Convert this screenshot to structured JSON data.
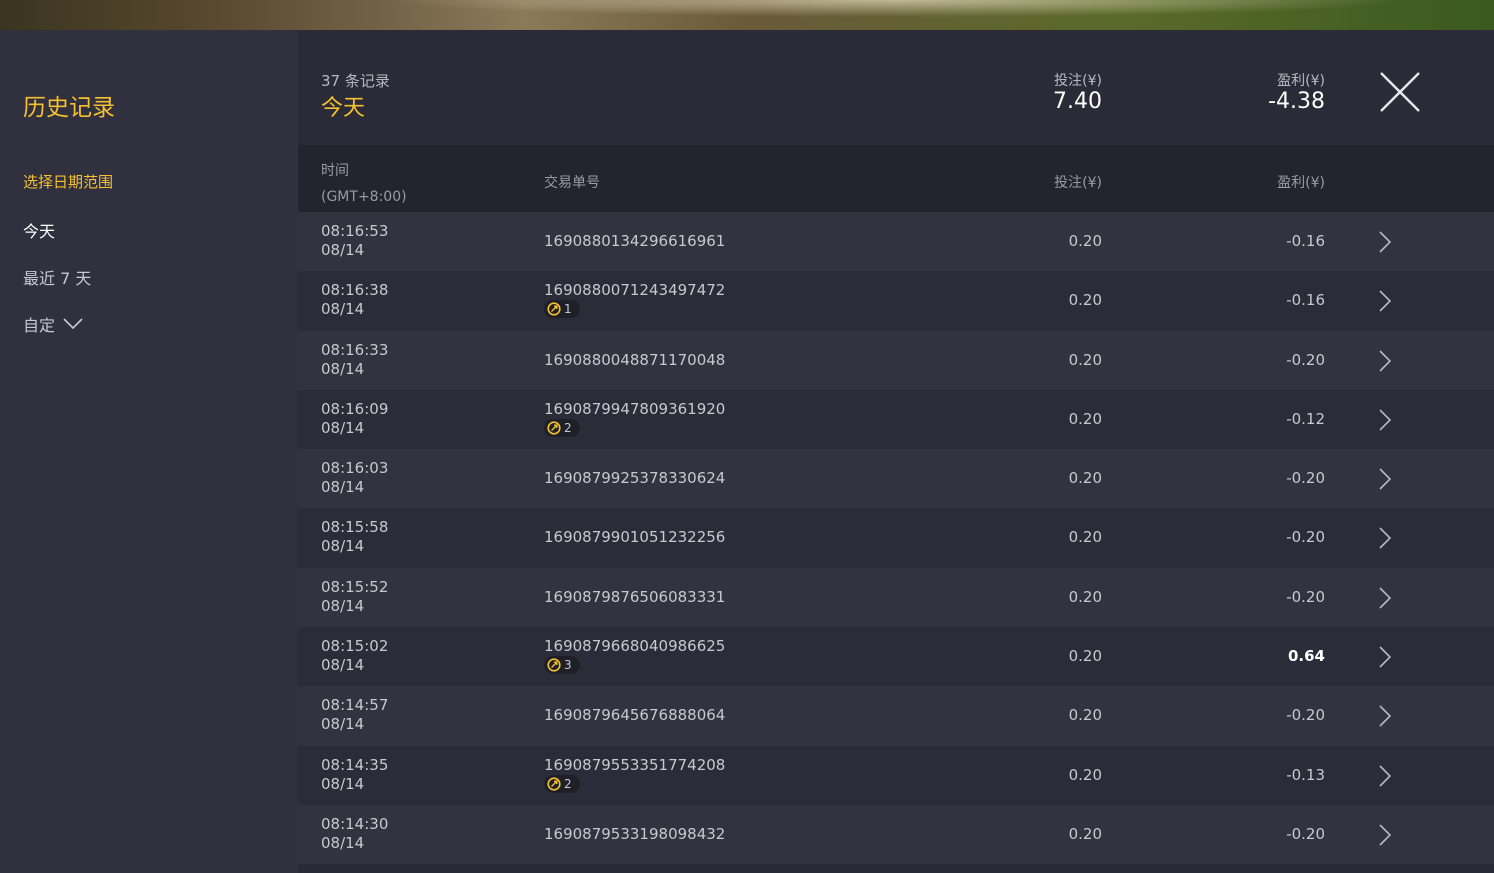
{
  "sidebar": {
    "title": "历史记录",
    "range_label": "选择日期范围",
    "options": {
      "today": "今天",
      "week": "最近 7 天",
      "custom": "自定"
    }
  },
  "header": {
    "count": "37 条记录",
    "period": "今天",
    "bet_label": "投注(¥)",
    "bet_total": "7.40",
    "pl_label": "盈利(¥)",
    "pl_total": "-4.38"
  },
  "columns": {
    "time": "时间",
    "timezone": "(GMT+8:00)",
    "txid": "交易单号",
    "bet": "投注(¥)",
    "pl": "盈利(¥)"
  },
  "rows": [
    {
      "time": "08:16:53",
      "date": "08/14",
      "txid": "1690880134296616961",
      "badge": "",
      "bet": "0.20",
      "pl": "-0.16"
    },
    {
      "time": "08:16:38",
      "date": "08/14",
      "txid": "1690880071243497472",
      "badge": "1",
      "bet": "0.20",
      "pl": "-0.16"
    },
    {
      "time": "08:16:33",
      "date": "08/14",
      "txid": "1690880048871170048",
      "badge": "",
      "bet": "0.20",
      "pl": "-0.20"
    },
    {
      "time": "08:16:09",
      "date": "08/14",
      "txid": "1690879947809361920",
      "badge": "2",
      "bet": "0.20",
      "pl": "-0.12"
    },
    {
      "time": "08:16:03",
      "date": "08/14",
      "txid": "1690879925378330624",
      "badge": "",
      "bet": "0.20",
      "pl": "-0.20"
    },
    {
      "time": "08:15:58",
      "date": "08/14",
      "txid": "1690879901051232256",
      "badge": "",
      "bet": "0.20",
      "pl": "-0.20"
    },
    {
      "time": "08:15:52",
      "date": "08/14",
      "txid": "1690879876506083331",
      "badge": "",
      "bet": "0.20",
      "pl": "-0.20"
    },
    {
      "time": "08:15:02",
      "date": "08/14",
      "txid": "1690879668040986625",
      "badge": "3",
      "bet": "0.20",
      "pl": "0.64"
    },
    {
      "time": "08:14:57",
      "date": "08/14",
      "txid": "1690879645676888064",
      "badge": "",
      "bet": "0.20",
      "pl": "-0.20"
    },
    {
      "time": "08:14:35",
      "date": "08/14",
      "txid": "1690879553351774208",
      "badge": "2",
      "bet": "0.20",
      "pl": "-0.13"
    },
    {
      "time": "08:14:30",
      "date": "08/14",
      "txid": "1690879533198098432",
      "badge": "",
      "bet": "0.20",
      "pl": "-0.20"
    }
  ],
  "icons": {
    "close": "close-icon",
    "row_arrow": "chevron-right-icon",
    "badge": "free-spin-icon",
    "dropdown": "chevron-down-icon"
  },
  "colors": {
    "accent": "#f5c12e",
    "text": "#c8c8d0",
    "background": "#2b2b38"
  }
}
